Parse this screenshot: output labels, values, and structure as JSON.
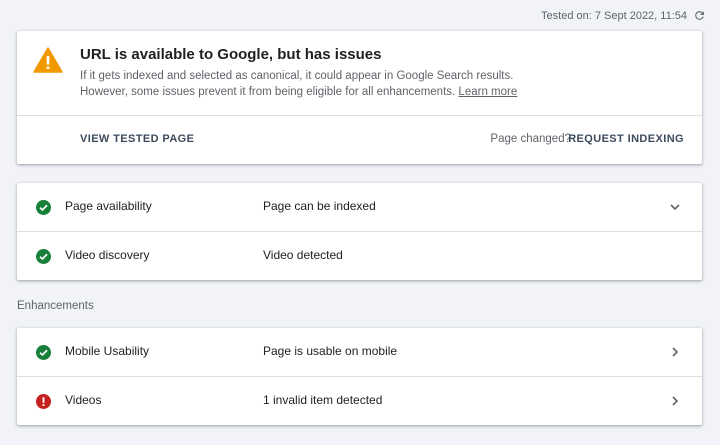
{
  "header": {
    "tested_on": "Tested on: 7 Sept 2022, 11:54",
    "refresh_icon": "refresh-icon"
  },
  "summary": {
    "status_icon": "warning-icon",
    "status_color": "#f29900",
    "title": "URL is available to Google, but has issues",
    "desc_line1": "If it gets indexed and selected as canonical, it could appear in Google Search results.",
    "desc_line2": "However, some issues prevent it from being eligible for all enhancements.",
    "learn_more": "Learn more",
    "view_tested_page": "VIEW TESTED PAGE",
    "page_changed": "Page changed?",
    "request_indexing": "REQUEST INDEXING"
  },
  "availability": {
    "rows": [
      {
        "label": "Page availability",
        "value": "Page can be indexed",
        "status": "valid",
        "chevron": "chevron-down-icon"
      },
      {
        "label": "Video discovery",
        "value": "Video detected",
        "status": "valid"
      }
    ]
  },
  "enhancements": {
    "heading": "Enhancements",
    "rows": [
      {
        "label": "Mobile Usability",
        "value": "Page is usable on mobile",
        "status": "valid",
        "chevron": "chevron-right-icon"
      },
      {
        "label": "Videos",
        "value": "1 invalid item detected",
        "status": "error",
        "chevron": "chevron-right-icon"
      }
    ]
  },
  "colors": {
    "valid": "#188038",
    "error": "#c5221f",
    "warning": "#f29900"
  }
}
